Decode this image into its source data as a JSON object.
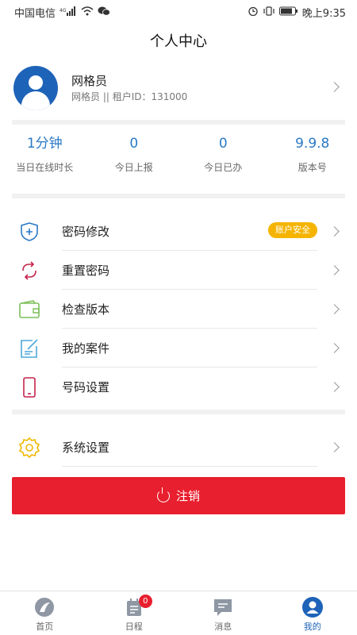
{
  "status_bar": {
    "carrier": "中国电信",
    "time": "晚上9:35",
    "left_icons": [
      "signal-icon",
      "wifi-icon",
      "wechat-icon"
    ],
    "right_icons": [
      "alarm-icon",
      "vibrate-icon",
      "battery-icon"
    ]
  },
  "header": {
    "title": "个人中心"
  },
  "profile": {
    "name": "网格员",
    "subtitle": "网格员 || 租户ID：131000"
  },
  "stats": [
    {
      "value": "1分钟",
      "label": "当日在线时长"
    },
    {
      "value": "0",
      "label": "今日上报"
    },
    {
      "value": "0",
      "label": "今日已办"
    },
    {
      "value": "9.9.8",
      "label": "版本号"
    }
  ],
  "menu": [
    {
      "label": "密码修改",
      "icon": "shield-plus-icon",
      "badge": "账户安全"
    },
    {
      "label": "重置密码",
      "icon": "refresh-icon"
    },
    {
      "label": "检查版本",
      "icon": "wallet-icon"
    },
    {
      "label": "我的案件",
      "icon": "edit-note-icon"
    },
    {
      "label": "号码设置",
      "icon": "phone-icon"
    }
  ],
  "settings": {
    "label": "系统设置",
    "icon": "gear-icon"
  },
  "logout": {
    "label": "注销"
  },
  "tabs": [
    {
      "label": "首页",
      "icon": "home-icon"
    },
    {
      "label": "日程",
      "icon": "schedule-icon",
      "badge": "0"
    },
    {
      "label": "消息",
      "icon": "message-icon"
    },
    {
      "label": "我的",
      "icon": "user-icon",
      "active": true
    }
  ],
  "colors": {
    "accent": "#1d63b8",
    "stat_value": "#2a79c6",
    "logout": "#e81f2e",
    "badge": "#f5b400"
  }
}
